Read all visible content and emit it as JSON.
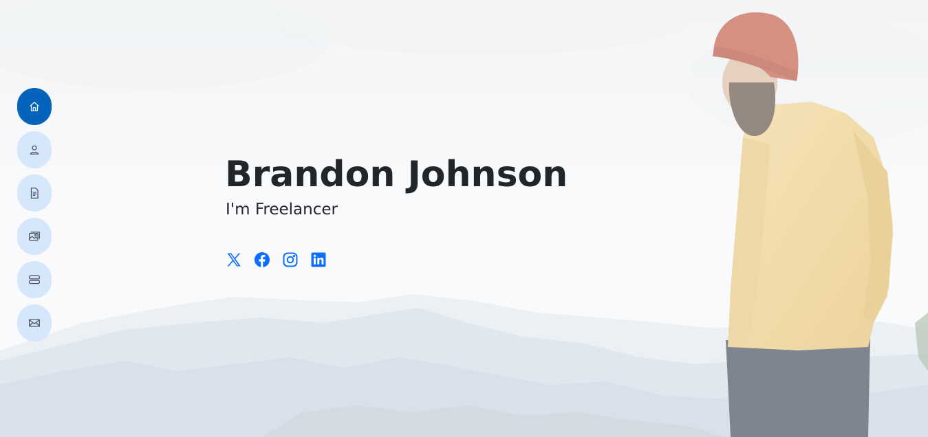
{
  "hero": {
    "name": "Brandon Johnson",
    "tagline_prefix": "I'm ",
    "tagline_role": "Freelancer"
  },
  "nav": {
    "items": [
      {
        "icon": "house-icon",
        "active": true
      },
      {
        "icon": "person-icon",
        "active": false
      },
      {
        "icon": "file-text-icon",
        "active": false
      },
      {
        "icon": "images-icon",
        "active": false
      },
      {
        "icon": "hdd-stack-icon",
        "active": false
      },
      {
        "icon": "envelope-icon",
        "active": false
      }
    ]
  },
  "socials": [
    {
      "icon": "x-twitter-icon"
    },
    {
      "icon": "facebook-icon"
    },
    {
      "icon": "instagram-icon"
    },
    {
      "icon": "linkedin-icon"
    }
  ],
  "colors": {
    "accent": "#0563bb",
    "nav_inactive_bg": "#d7e7fb",
    "social_blue": "#0d6efd",
    "heading_text": "#22262a"
  }
}
